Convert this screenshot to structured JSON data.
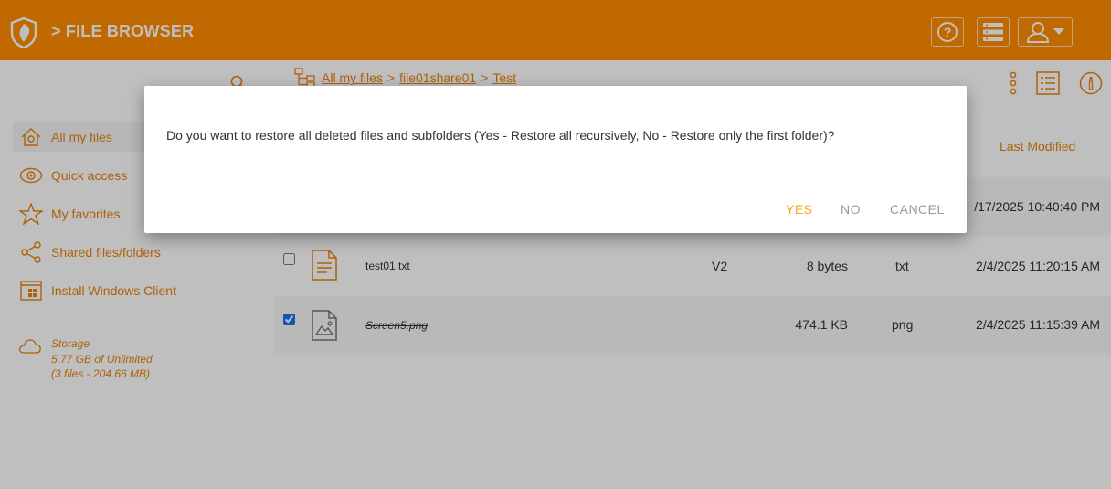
{
  "header": {
    "title": "> FILE BROWSER"
  },
  "sidebar": {
    "items": [
      {
        "label": "All my files",
        "icon": "home-icon"
      },
      {
        "label": "Quick access",
        "icon": "eye-icon"
      },
      {
        "label": "My favorites",
        "icon": "star-icon"
      },
      {
        "label": "Shared files/folders",
        "icon": "share-icon"
      },
      {
        "label": "Install Windows Client",
        "icon": "windows-client-icon"
      }
    ],
    "storage": {
      "label": "Storage",
      "usage": "5.77 GB of Unlimited",
      "detail": "(3 files - 204.66 MB)"
    }
  },
  "breadcrumb": {
    "root": "All my files",
    "sep1": ">",
    "share": "file01share01",
    "sep2": ">",
    "folder": "Test"
  },
  "columns": {
    "last_modified": "Last Modified"
  },
  "rows": [
    {
      "modified": "/17/2025 10:40:40 PM"
    },
    {
      "name": "test01.txt",
      "version": "V2",
      "size": "8 bytes",
      "type": "txt",
      "modified": "2/4/2025 11:20:15 AM",
      "checked": false
    },
    {
      "name": "Screen5.png",
      "version": "",
      "size": "474.1 KB",
      "type": "png",
      "modified": "2/4/2025 11:15:39 AM",
      "checked": true
    }
  ],
  "dialog": {
    "message": "Do you want to restore all deleted files and subfolders (Yes - Restore all recursively, No - Restore only the first folder)?",
    "yes": "YES",
    "no": "NO",
    "cancel": "CANCEL"
  },
  "colors": {
    "accent": "#ff8c00",
    "text_accent": "#e8820c"
  }
}
